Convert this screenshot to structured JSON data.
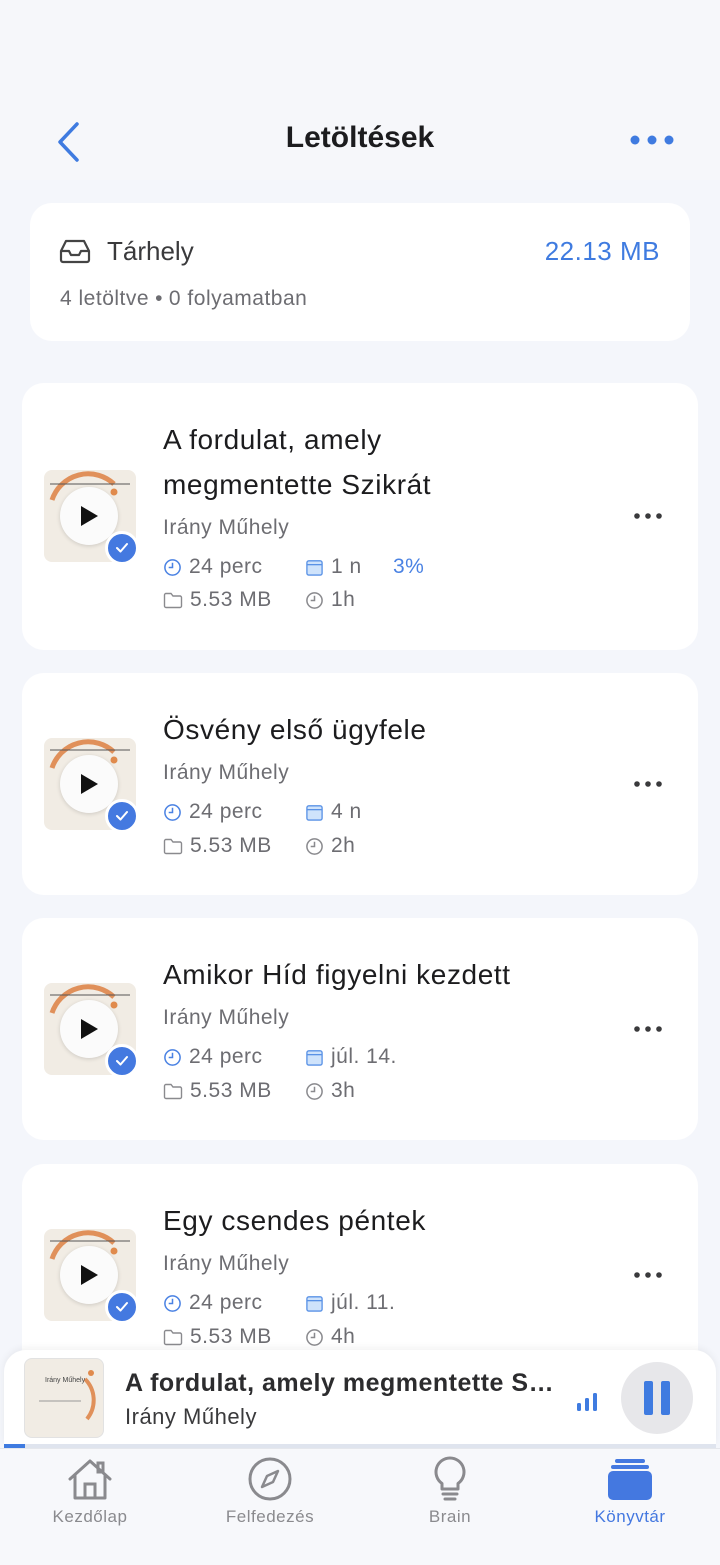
{
  "header": {
    "title": "Letöltések"
  },
  "storage": {
    "label": "Tárhely",
    "size": "22.13 MB",
    "downloaded": "4 letöltve",
    "separator": "•",
    "in_progress": "0 folyamatban"
  },
  "episodes": [
    {
      "title": "A fordulat, amely megmentette Szikrát",
      "author": "Irány Műhely",
      "duration": "24 perc",
      "date": "1 n",
      "progress": "3%",
      "size": "5.53 MB",
      "ago": "1h"
    },
    {
      "title": "Ösvény első ügyfele",
      "author": "Irány Műhely",
      "duration": "24 perc",
      "date": "4 n",
      "size": "5.53 MB",
      "ago": "2h"
    },
    {
      "title": "Amikor Híd figyelni kezdett",
      "author": "Irány Műhely",
      "duration": "24 perc",
      "date": "júl. 14.",
      "size": "5.53 MB",
      "ago": "3h"
    },
    {
      "title": "Egy csendes péntek",
      "author": "Irány Műhely",
      "duration": "24 perc",
      "date": "júl. 11.",
      "size": "5.53 MB",
      "ago": "4h"
    }
  ],
  "mini_player": {
    "title": "A fordulat, amely megmentette Szikrát",
    "author": "Irány Műhely",
    "artwork_text": "Irány Műhely",
    "progress": 0.03
  },
  "tabs": [
    {
      "label": "Kezdőlap",
      "icon": "home-icon"
    },
    {
      "label": "Felfedezés",
      "icon": "compass-icon"
    },
    {
      "label": "Brain",
      "icon": "lightbulb-icon"
    },
    {
      "label": "Könyvtár",
      "icon": "library-icon",
      "active": true
    }
  ],
  "colors": {
    "accent": "#3f7be0",
    "background": "#f4f6fb",
    "card": "#ffffff"
  }
}
